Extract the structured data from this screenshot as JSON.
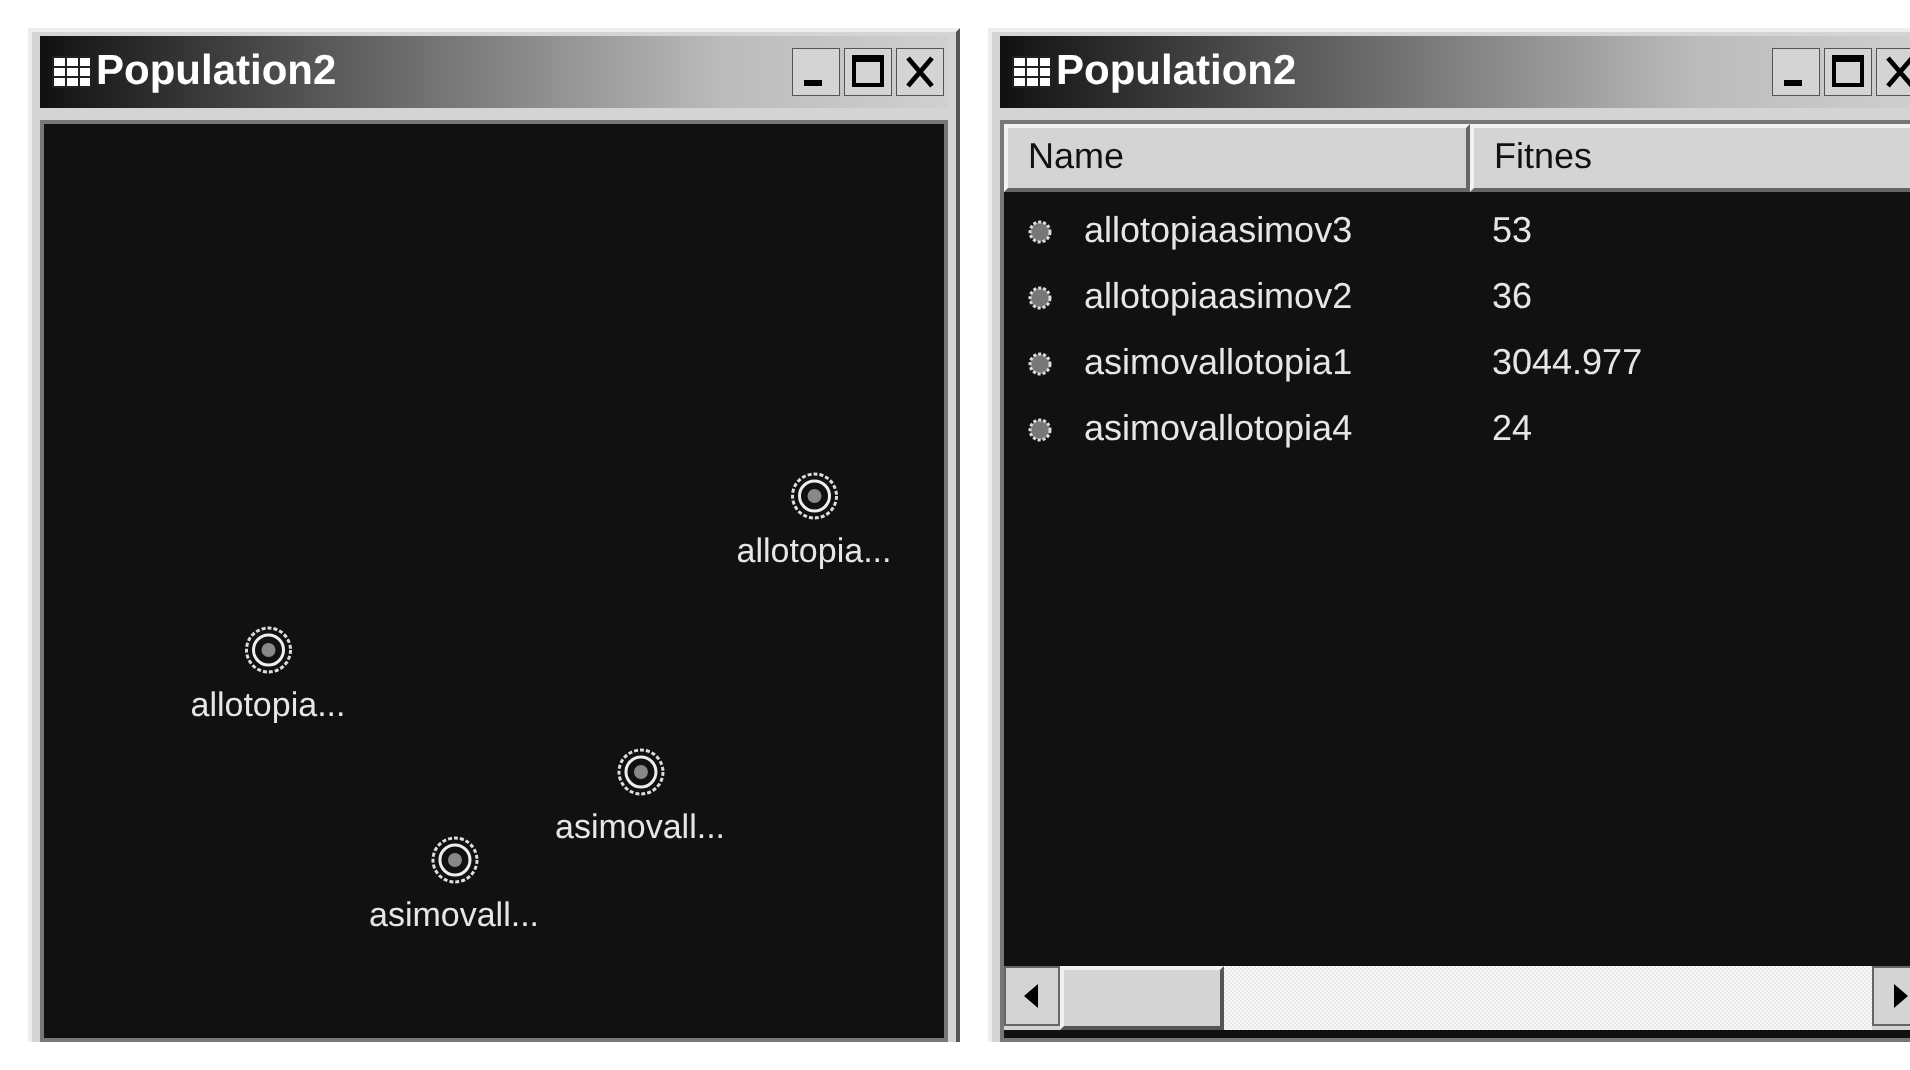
{
  "windows": [
    {
      "title": "Population2",
      "kind": "canvas",
      "nodes": [
        {
          "label": "allotopia..."
        },
        {
          "label": "allotopia..."
        },
        {
          "label": "asimovall..."
        },
        {
          "label": "asimovall..."
        }
      ]
    },
    {
      "title": "Population2",
      "kind": "list",
      "columns": [
        "Name",
        "Fitnes"
      ],
      "rows": [
        {
          "name": "allotopiaasimov3",
          "fitness": "53"
        },
        {
          "name": "allotopiaasimov2",
          "fitness": "36"
        },
        {
          "name": "asimovallotopia1",
          "fitness": "3044.977"
        },
        {
          "name": "asimovallotopia4",
          "fitness": "24"
        }
      ]
    }
  ]
}
